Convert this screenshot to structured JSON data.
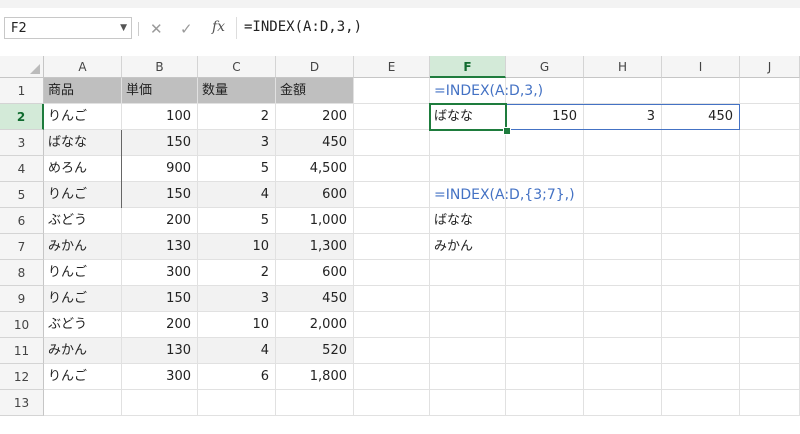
{
  "namebox": {
    "value": "F2"
  },
  "formula_bar": {
    "fx_label": "fx",
    "formula": "=INDEX(A:D,3,)",
    "cancel_icon": "close-icon",
    "enter_icon": "check-icon"
  },
  "columns": [
    "A",
    "B",
    "C",
    "D",
    "E",
    "F",
    "G",
    "H",
    "I",
    "J"
  ],
  "selected_column": "F",
  "rows": [
    "1",
    "2",
    "3",
    "4",
    "5",
    "6",
    "7",
    "8",
    "9",
    "10",
    "11",
    "12",
    "13"
  ],
  "selected_row": "2",
  "table": {
    "headers": [
      "商品",
      "単価",
      "数量",
      "金額"
    ],
    "rows": [
      [
        "りんご",
        "100",
        "2",
        "200"
      ],
      [
        "ばなな",
        "150",
        "3",
        "450"
      ],
      [
        "めろん",
        "900",
        "5",
        "4,500"
      ],
      [
        "りんご",
        "150",
        "4",
        "600"
      ],
      [
        "ぶどう",
        "200",
        "5",
        "1,000"
      ],
      [
        "みかん",
        "130",
        "10",
        "1,300"
      ],
      [
        "りんご",
        "300",
        "2",
        "600"
      ],
      [
        "りんご",
        "150",
        "3",
        "450"
      ],
      [
        "ぶどう",
        "200",
        "10",
        "2,000"
      ],
      [
        "みかん",
        "130",
        "4",
        "520"
      ],
      [
        "りんご",
        "300",
        "6",
        "1,800"
      ]
    ]
  },
  "side": {
    "formula1": "=INDEX(A:D,3,)",
    "result1": [
      "ばなな",
      "150",
      "3",
      "450"
    ],
    "formula2": "=INDEX(A:D,{3;7},)",
    "result2": [
      "ばなな",
      "みかん"
    ]
  },
  "colors": {
    "selection": "#1e7c3d",
    "formula_text": "#4472c4",
    "header_fill": "#bfbfbf",
    "band_fill": "#f2f2f2"
  }
}
